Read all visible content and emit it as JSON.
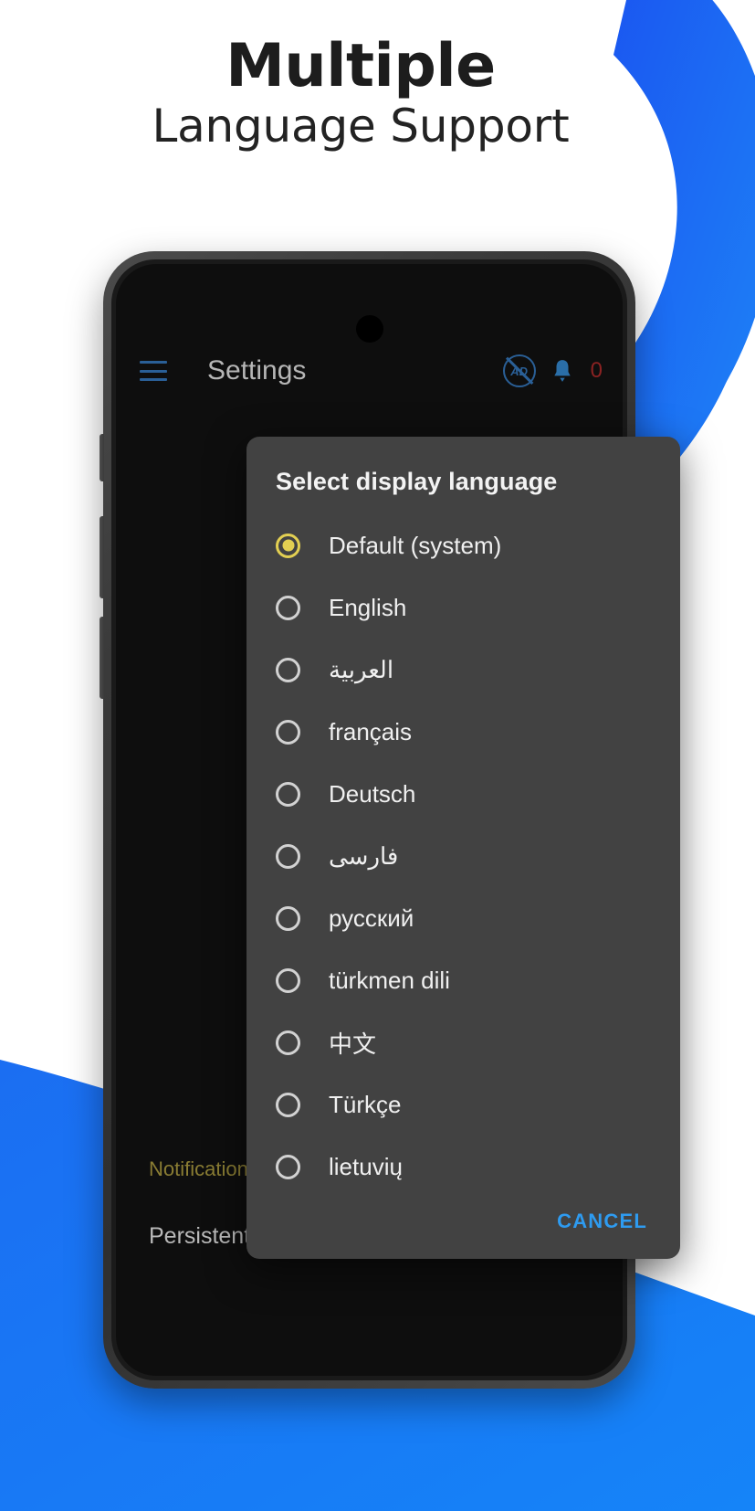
{
  "headline": {
    "line1": "Multiple",
    "line2": "Language Support"
  },
  "colors": {
    "brand_blue": "#1a6df0",
    "swirl_blue": "#1479f5",
    "accent_yellow": "#e2cf52",
    "cancel_blue": "#2e9bf0",
    "badge_red": "#8a2222",
    "dialog_bg": "#424242",
    "screen_bg": "#0e0e0e"
  },
  "appbar": {
    "menu_icon": "hamburger-menu-icon",
    "title": "Settings",
    "adblock_icon": "ad-block-icon",
    "adblock_label": "AD",
    "bell_icon": "bell-notification-icon",
    "badge_count": "0"
  },
  "settings_background": {
    "section_header": "Notifications",
    "preference_row": "Persistent notification"
  },
  "dialog": {
    "title": "Select display language",
    "languages": [
      {
        "label": "Default (system)",
        "selected": true,
        "rtl": false
      },
      {
        "label": "English",
        "selected": false,
        "rtl": false
      },
      {
        "label": "العربية",
        "selected": false,
        "rtl": true
      },
      {
        "label": "français",
        "selected": false,
        "rtl": false
      },
      {
        "label": "Deutsch",
        "selected": false,
        "rtl": false
      },
      {
        "label": "فارسی",
        "selected": false,
        "rtl": true
      },
      {
        "label": "русский",
        "selected": false,
        "rtl": false
      },
      {
        "label": "türkmen dili",
        "selected": false,
        "rtl": false
      },
      {
        "label": "中文",
        "selected": false,
        "rtl": false
      },
      {
        "label": "Türkçe",
        "selected": false,
        "rtl": false
      },
      {
        "label": "lietuvių",
        "selected": false,
        "rtl": false
      }
    ],
    "cancel_label": "CANCEL"
  }
}
